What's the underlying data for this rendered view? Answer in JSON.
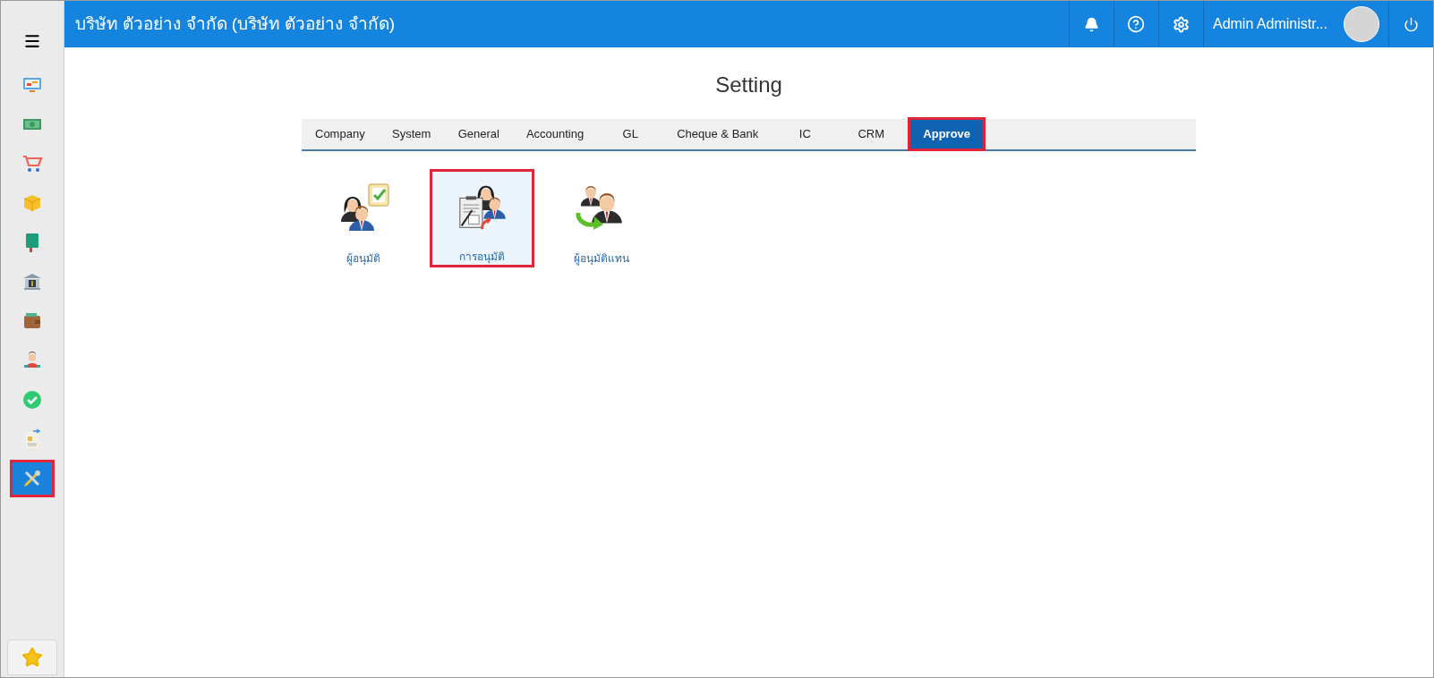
{
  "header": {
    "company": "บริษัท ตัวอย่าง จำกัด (บริษัท ตัวอย่าง จำกัด)",
    "user_name": "Admin Administr..."
  },
  "sidebar": {
    "items": [
      {
        "kind": "presentation",
        "selected": false
      },
      {
        "kind": "money",
        "selected": false
      },
      {
        "kind": "cart",
        "selected": false
      },
      {
        "kind": "box",
        "selected": false
      },
      {
        "kind": "book",
        "selected": false
      },
      {
        "kind": "bank",
        "selected": false
      },
      {
        "kind": "wallet",
        "selected": false
      },
      {
        "kind": "people",
        "selected": false
      },
      {
        "kind": "check",
        "selected": false
      },
      {
        "kind": "invoice",
        "selected": false
      },
      {
        "kind": "tools",
        "selected": true
      }
    ]
  },
  "page": {
    "title": "Setting"
  },
  "tabs": [
    {
      "label": "Company",
      "selected": false
    },
    {
      "label": "System",
      "selected": false
    },
    {
      "label": "General",
      "selected": false
    },
    {
      "label": "Accounting",
      "selected": false
    },
    {
      "label": "GL",
      "selected": false
    },
    {
      "label": "Cheque & Bank",
      "selected": false
    },
    {
      "label": "IC",
      "selected": false
    },
    {
      "label": "CRM",
      "selected": false
    },
    {
      "label": "Approve",
      "selected": true
    }
  ],
  "tiles": [
    {
      "kind": "approver",
      "label": "ผู้อนุมัติ",
      "selected": false
    },
    {
      "kind": "approval",
      "label": "การอนุมัติ",
      "selected": true
    },
    {
      "kind": "delegate",
      "label": "ผู้อนุมัติแทน",
      "selected": false
    }
  ]
}
